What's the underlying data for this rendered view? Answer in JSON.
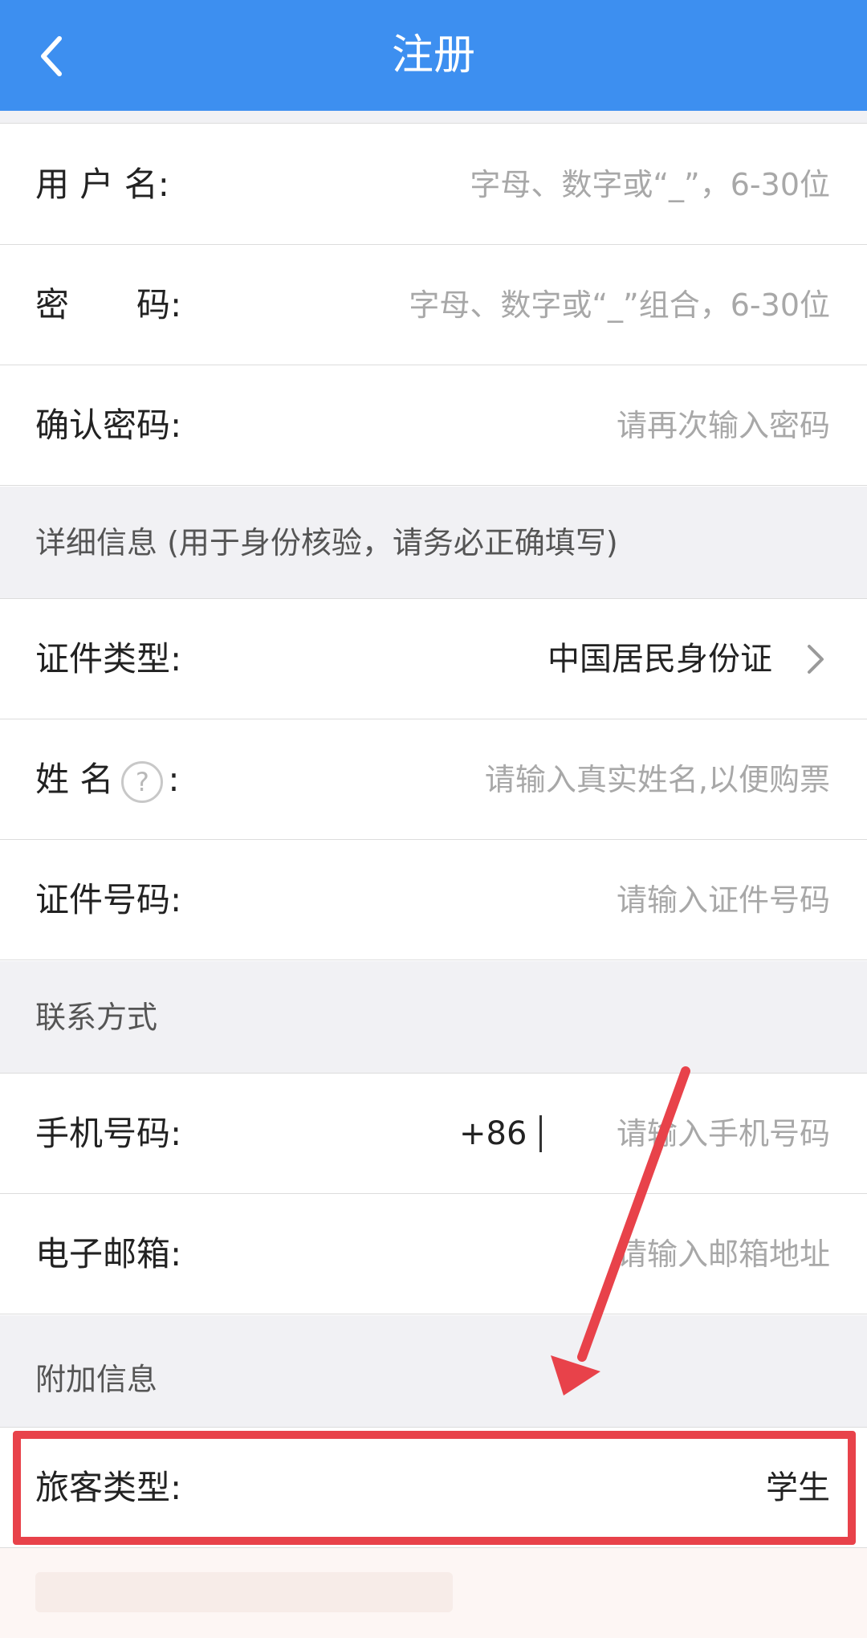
{
  "header": {
    "title": "注册"
  },
  "account": {
    "username_label": "用 户 名:",
    "username_placeholder": "字母、数字或“_”，6-30位",
    "password_label": "密　　码:",
    "password_placeholder": "字母、数字或“_”组合，6-30位",
    "confirm_label": "确认密码:",
    "confirm_placeholder": "请再次输入密码"
  },
  "details": {
    "section_title": "详细信息 (用于身份核验，请务必正确填写)",
    "idtype_label": "证件类型:",
    "idtype_value": "中国居民身份证",
    "name_label": "姓 名",
    "name_help_glyph": "?",
    "name_colon": ":",
    "name_placeholder": "请输入真实姓名,以便购票",
    "idnumber_label": "证件号码:",
    "idnumber_placeholder": "请输入证件号码"
  },
  "contact": {
    "section_title": "联系方式",
    "phone_label": "手机号码:",
    "phone_prefix": "+86",
    "phone_placeholder": "请输入手机号码",
    "email_label": "电子邮箱:",
    "email_placeholder": "请输入邮箱地址"
  },
  "extra": {
    "section_title": "附加信息",
    "passenger_type_label": "旅客类型:",
    "passenger_type_value": "学生"
  },
  "colors": {
    "header_bg": "#3d8ff0",
    "annotation": "#e8424a",
    "section_bg": "#f1f1f4"
  },
  "icons": [
    "back-chevron-icon",
    "help-circle-icon",
    "chevron-right-icon",
    "annotation-arrow-icon"
  ]
}
